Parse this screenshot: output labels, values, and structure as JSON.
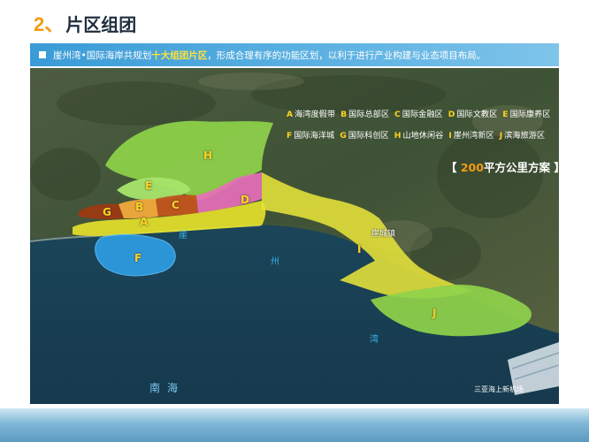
{
  "title": {
    "number": "2",
    "sep": "、",
    "text": "片区组团"
  },
  "banner": {
    "text_before": "崖州湾•国际海岸共规划",
    "highlight": "十大组团片区",
    "text_after": "，形成合理有序的功能区划，以利于进行产业构建与业态项目布局。"
  },
  "legend": [
    {
      "letter": "A",
      "name": "海湾度假带"
    },
    {
      "letter": "B",
      "name": "国际总部区"
    },
    {
      "letter": "C",
      "name": "国际金融区"
    },
    {
      "letter": "D",
      "name": "国际文教区"
    },
    {
      "letter": "E",
      "name": "国际康养区"
    },
    {
      "letter": "F",
      "name": "国际海洋城"
    },
    {
      "letter": "G",
      "name": "国际科创区"
    },
    {
      "letter": "H",
      "name": "山地休闲谷"
    },
    {
      "letter": "I",
      "name": "崖州湾新区"
    },
    {
      "letter": "J",
      "name": "滨海旅游区"
    }
  ],
  "scheme": {
    "bracket_open": "【 ",
    "number": "200",
    "text": "平方公里方案",
    "bracket_close": " 】"
  },
  "zone_colors": {
    "A": "#e8e32a",
    "B": "#f2a93b",
    "C": "#c2541b",
    "D": "#e66fb8",
    "E": "#a6e56a",
    "F": "#2e9ee6",
    "G": "#9c3a12",
    "H": "#8fd34a",
    "I": "#e6e23a",
    "J": "#8fd34a"
  },
  "map_labels": {
    "bay1": "崖",
    "bay2": "州",
    "bay3": "湾",
    "sea": "南海",
    "town": "崖城镇",
    "airport": "三亚海上新机场"
  }
}
